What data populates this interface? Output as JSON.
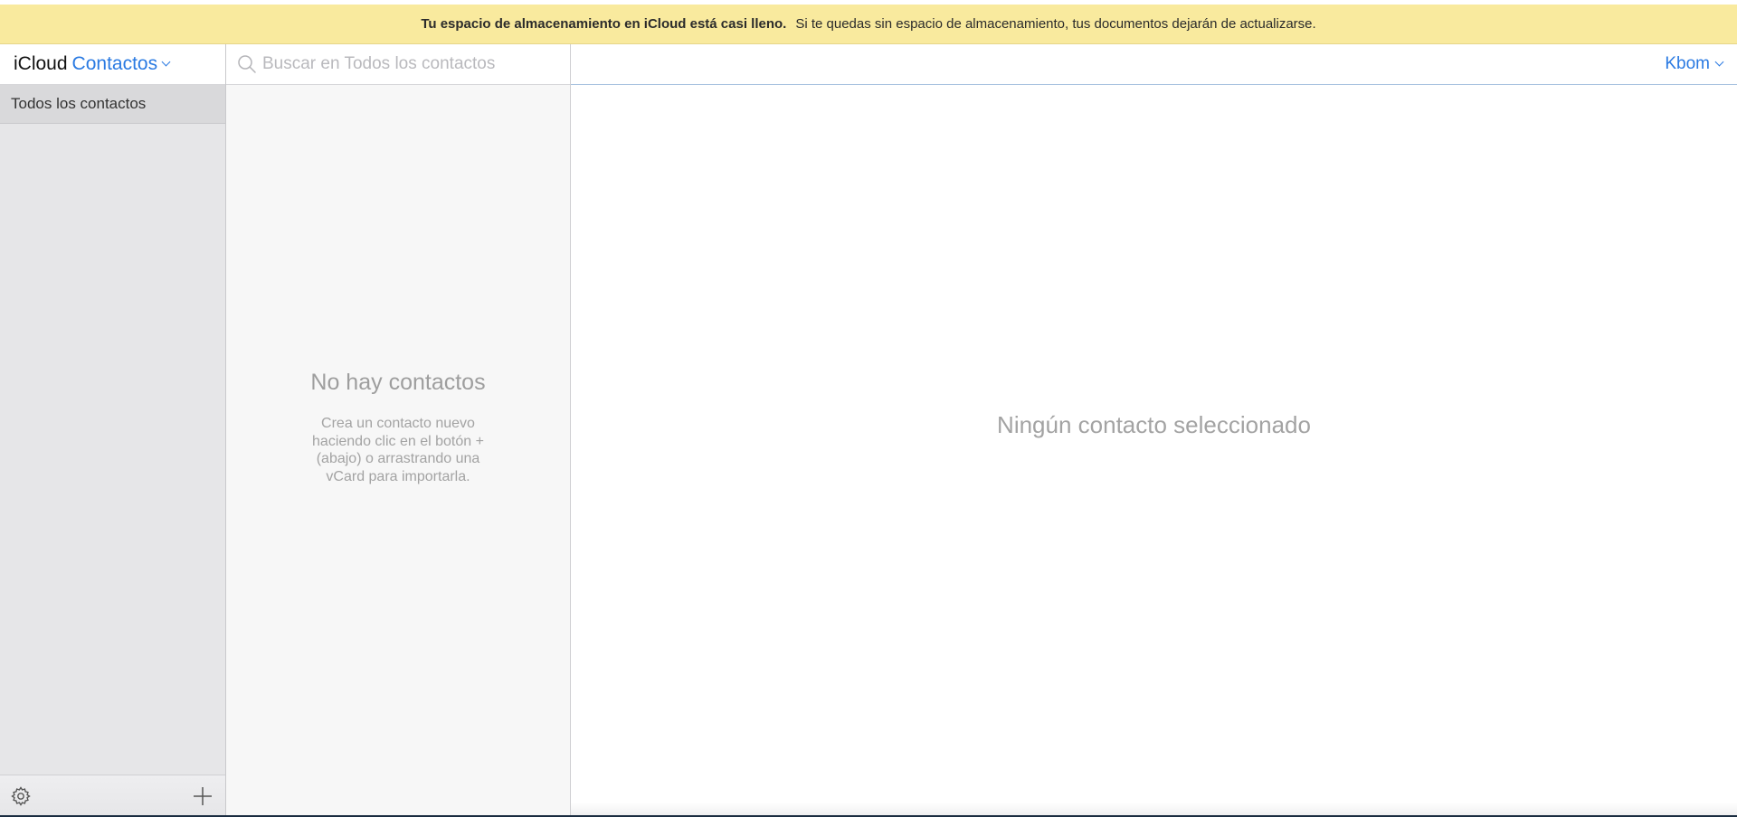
{
  "banner": {
    "bold_text": "Tu espacio de almacenamiento en iCloud está casi lleno.",
    "text": "Si te quedas sin espacio de almacenamiento, tus documentos dejarán de actualizarse."
  },
  "sidebar": {
    "app_name": "iCloud",
    "app_section": "Contactos",
    "groups": [
      {
        "label": "Todos los contactos",
        "selected": true
      }
    ],
    "footer": {
      "settings_icon": "gear-icon",
      "add_icon": "plus-icon"
    }
  },
  "contact_list": {
    "search_placeholder": "Buscar en Todos los contactos",
    "search_value": "",
    "empty_title": "No hay contactos",
    "empty_description": "Crea un contacto nuevo haciendo clic en el botón + (abajo) o arrastrando una vCard para importarla."
  },
  "detail": {
    "account_name": "Kbom",
    "empty_message": "Ningún contacto seleccionado"
  },
  "colors": {
    "accent": "#2a7ae2",
    "banner_background": "#f9ea9e",
    "sidebar_background": "#e6e6e8",
    "list_background": "#f7f7f7"
  }
}
